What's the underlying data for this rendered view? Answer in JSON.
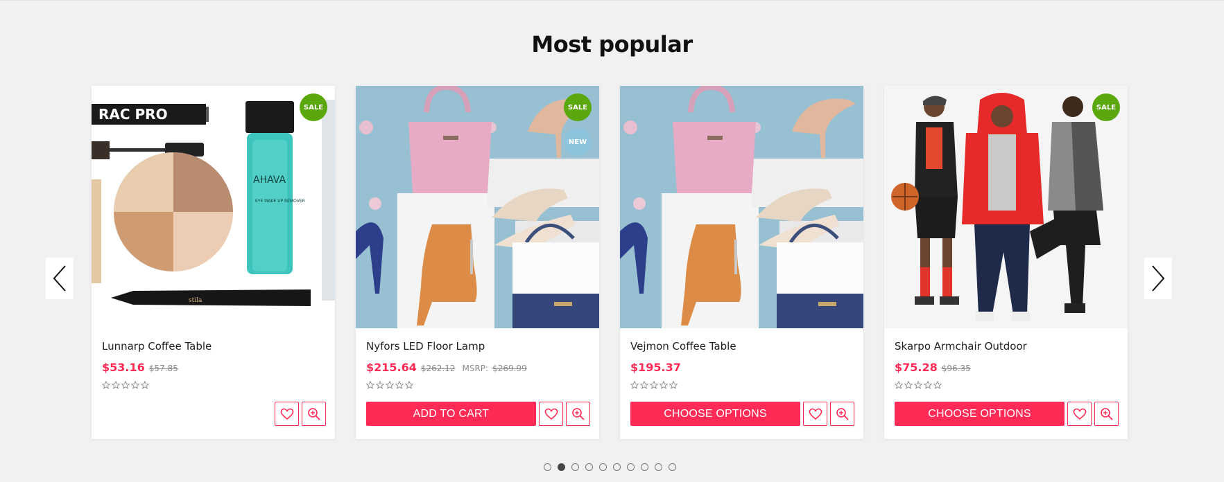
{
  "section": {
    "title": "Most popular"
  },
  "carousel": {
    "active_dot": 1,
    "dot_count": 10
  },
  "products": [
    {
      "name": "Lunnarp Coffee Table",
      "price": "$53.16",
      "old_price": "$57.85",
      "msrp_label": "",
      "msrp_value": "",
      "badges": [
        "SALE"
      ],
      "action": "",
      "rating": 0
    },
    {
      "name": "Nyfors LED Floor Lamp",
      "price": "$215.64",
      "old_price": "$262.12",
      "msrp_label": "MSRP:",
      "msrp_value": "$269.99",
      "badges": [
        "SALE",
        "NEW"
      ],
      "action": "ADD TO CART",
      "rating": 0
    },
    {
      "name": "Vejmon Coffee Table",
      "price": "$195.37",
      "old_price": "",
      "msrp_label": "",
      "msrp_value": "",
      "badges": [],
      "action": "CHOOSE OPTIONS",
      "rating": 0
    },
    {
      "name": "Skarpo Armchair Outdoor",
      "price": "$75.28",
      "old_price": "$96.35",
      "msrp_label": "",
      "msrp_value": "",
      "badges": [
        "SALE"
      ],
      "action": "CHOOSE OPTIONS",
      "rating": 0
    }
  ],
  "image_text": {
    "brand_pro": "RAC PRO",
    "brand_ahava": "AHAVA",
    "ahava_sub": "EYE MAKE UP REMOVER",
    "brand_stila": "stila"
  },
  "colors": {
    "accent": "#ff2b56",
    "sale_badge": "#5aa80d",
    "new_badge": "#8ec3dd",
    "background": "#f1f1f1"
  },
  "icons": {
    "prev": "chevron-left-icon",
    "next": "chevron-right-icon",
    "wishlist": "heart-icon",
    "quickview": "zoom-in-icon",
    "rating": "star-outline-icon"
  }
}
